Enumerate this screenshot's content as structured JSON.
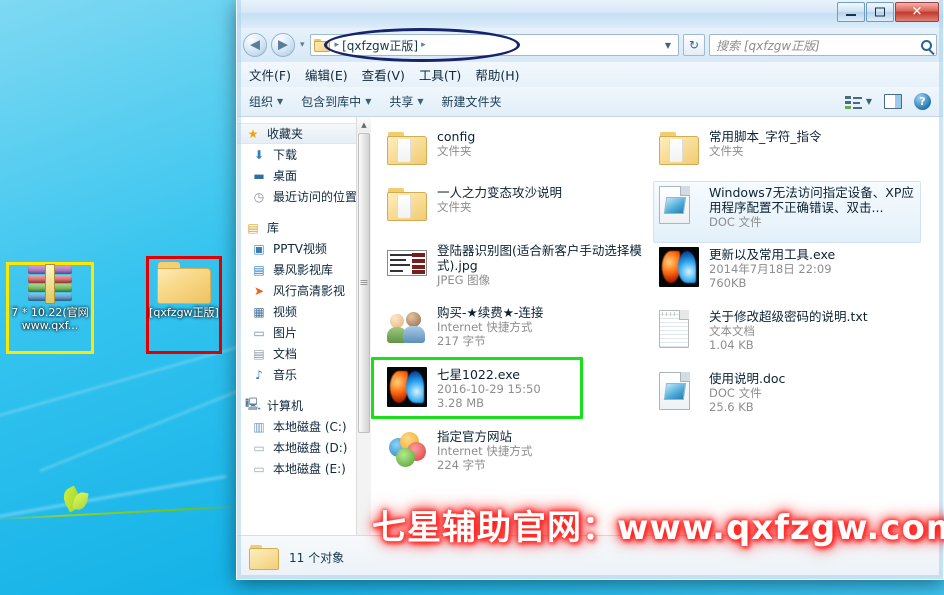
{
  "window": {
    "title": "",
    "controls": {
      "minimize": "–",
      "maximize": "❐",
      "close": "✕"
    }
  },
  "nav": {
    "back_icon": "◀",
    "forward_icon": "▶",
    "history_caret": "▾",
    "breadcrumb": "[qxfzgw正版]",
    "breadcrumb_sep": "▸",
    "address_caret": "▼",
    "refresh_icon": "↻",
    "search_placeholder": "搜索 [qxfzgw正版]"
  },
  "menubar": {
    "items": [
      {
        "label": "文件(F)"
      },
      {
        "label": "编辑(E)"
      },
      {
        "label": "查看(V)"
      },
      {
        "label": "工具(T)"
      },
      {
        "label": "帮助(H)"
      }
    ]
  },
  "toolbar": {
    "organize": "组织",
    "include_in_library": "包含到库中",
    "share": "共享",
    "new_folder": "新建文件夹",
    "caret": "▼",
    "help_glyph": "?"
  },
  "sidebar": {
    "favorites": {
      "label": "收藏夹",
      "icon": "★",
      "items": [
        {
          "label": "下载",
          "icon": "⬇"
        },
        {
          "label": "桌面",
          "icon": "🖥"
        },
        {
          "label": "最近访问的位置",
          "icon": "🕘"
        }
      ]
    },
    "libraries": {
      "label": "库",
      "icon": "▤",
      "items": [
        {
          "label": "PPTV视频",
          "icon": "▣"
        },
        {
          "label": "暴风影视库",
          "icon": "▤"
        },
        {
          "label": "风行高清影视",
          "icon": "➤"
        },
        {
          "label": "视频",
          "icon": "🎞"
        },
        {
          "label": "图片",
          "icon": "🖼"
        },
        {
          "label": "文档",
          "icon": "📄"
        },
        {
          "label": "音乐",
          "icon": "♪"
        }
      ]
    },
    "computer": {
      "label": "计算机",
      "icon": "🖳",
      "items": [
        {
          "label": "本地磁盘 (C:)",
          "icon": "💾"
        },
        {
          "label": "本地磁盘 (D:)",
          "icon": "▭"
        },
        {
          "label": "本地磁盘 (E:)",
          "icon": "▭"
        }
      ]
    }
  },
  "files": {
    "column1": [
      {
        "name": "config",
        "type": "文件夹",
        "size": "",
        "icon": "folder"
      },
      {
        "name": "一人之力变态攻沙说明",
        "type": "文件夹",
        "size": "",
        "icon": "folder"
      },
      {
        "name": "登陆器识别图(适合新客户手动选择模式).jpg",
        "type": "JPEG 图像",
        "size": "",
        "icon": "screenshot"
      },
      {
        "name": "购买-★续费★-连接",
        "type": "Internet 快捷方式",
        "size": "217 字节",
        "icon": "people"
      },
      {
        "name": "七星1022.exe",
        "type": "2016-10-29 15:50",
        "size": "3.28 MB",
        "icon": "yinyang",
        "selected": true
      },
      {
        "name": "指定官方网站",
        "type": "Internet 快捷方式",
        "size": "224 字节",
        "icon": "flower"
      }
    ],
    "column2": [
      {
        "name": "常用脚本_字符_指令",
        "type": "文件夹",
        "size": "",
        "icon": "folder"
      },
      {
        "name": "Windows7无法访问指定设备、XP应用程序配置不正确错误、双击...",
        "type": "DOC 文件",
        "size": "",
        "icon": "doc",
        "hover": true
      },
      {
        "name": "更新以及常用工具.exe",
        "type": "2014年7月18日 22:09",
        "size": "760KB",
        "icon": "yinyang"
      },
      {
        "name": "关于修改超级密码的说明.txt",
        "type": "文本文档",
        "size": "1.04 KB",
        "icon": "txt"
      },
      {
        "name": "使用说明.doc",
        "type": "DOC 文件",
        "size": "25.6 KB",
        "icon": "doc"
      }
    ]
  },
  "status": {
    "count": "11 个对象"
  },
  "desktop": {
    "icons": [
      {
        "label": "7 * 10.22(官网www.qxf...",
        "icon": "winrar-archive",
        "highlight": "#ffe800"
      },
      {
        "label": "[qxfzgw正版]",
        "icon": "folder",
        "highlight": "#e00000"
      }
    ]
  },
  "watermark": {
    "text": "七星辅助官网：www.qxfzgw.com",
    "color": "#ffffff",
    "glow": "#ff0000"
  },
  "annotations": {
    "address_ellipse_color": "#15246b",
    "selection_box_color": "#19e019"
  }
}
